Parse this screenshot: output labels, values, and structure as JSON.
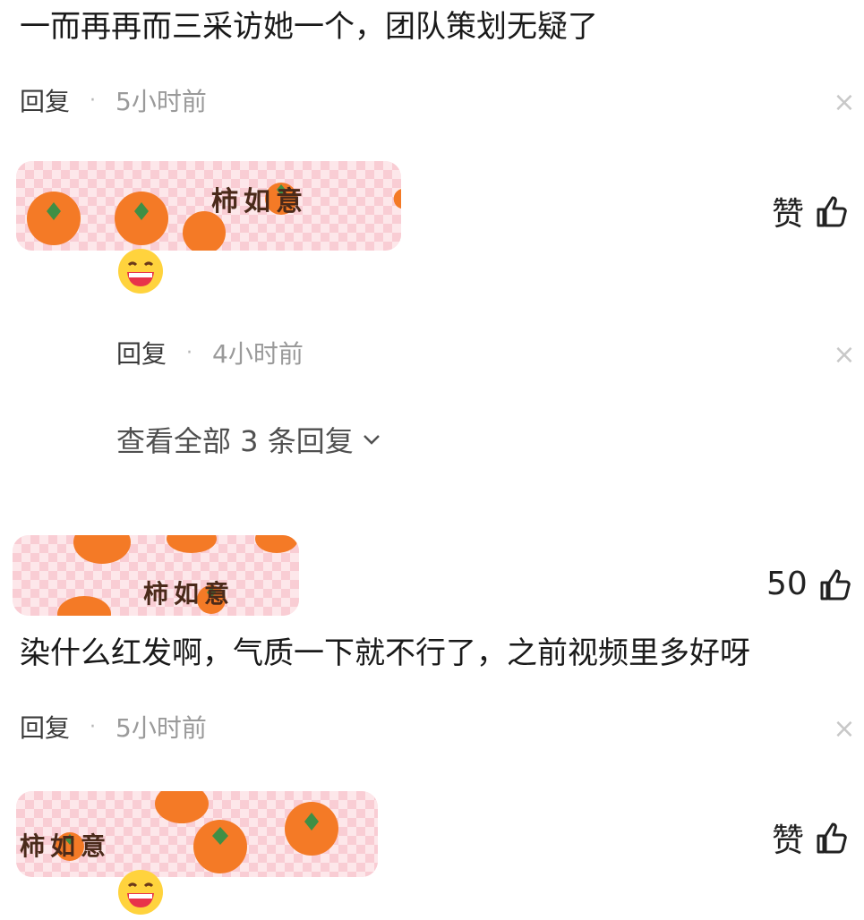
{
  "comments": [
    {
      "text": "一而再再而三采访她一个，团队策划无疑了",
      "reply_label": "回复",
      "separator": "·",
      "time": "5小时前"
    },
    {
      "sticker_text": "柿如意",
      "like_label": "赞",
      "reply_label": "回复",
      "separator": "·",
      "time": "4小时前",
      "view_all": "查看全部 3 条回复"
    },
    {
      "sticker_text": "柿如意",
      "like_count": "50",
      "text": "染什么红发啊，气质一下就不行了，之前视频里多好呀",
      "reply_label": "回复",
      "separator": "·",
      "time": "5小时前"
    },
    {
      "sticker_text": "柿如意",
      "like_label": "赞"
    }
  ],
  "icons": {
    "close": "close-icon",
    "like": "thumbs-up-icon",
    "chevron": "chevron-down-icon",
    "emoji": "laughing-emoji-icon"
  },
  "colors": {
    "text": "#1a1a1a",
    "meta": "#9a9a9a",
    "sticker_bg": "#fbd9de",
    "persimmon": "#f47a26",
    "leaf": "#3f8f45"
  }
}
